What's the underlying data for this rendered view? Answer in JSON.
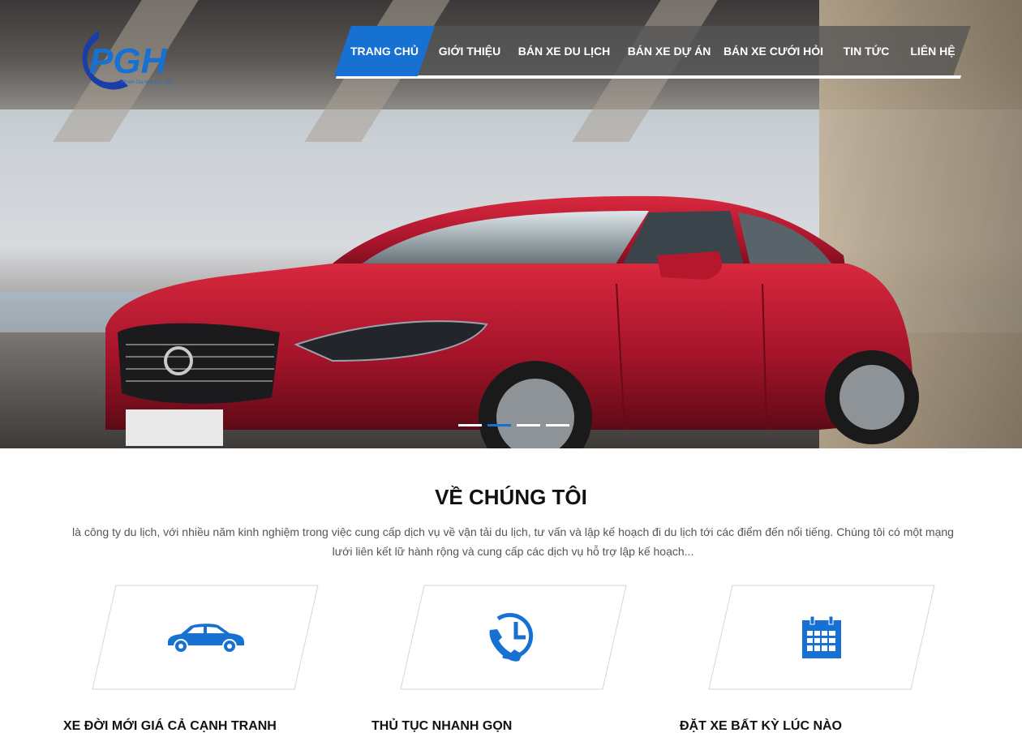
{
  "brand": {
    "logo_text": "PGH",
    "logo_subtext": "Pham Gia Huy Co., Ltd",
    "primary_color": "#1771d3",
    "dark_blue": "#1a3ea8"
  },
  "nav": {
    "items": [
      {
        "label": "TRANG CHỦ",
        "active": true
      },
      {
        "label": "GIỚI THIỆU"
      },
      {
        "label": "BÁN XE DU LỊCH"
      },
      {
        "label": "BÁN XE DỰ ÁN"
      },
      {
        "label": "BÁN XE CƯỚI HỎI"
      },
      {
        "label": "TIN TỨC"
      },
      {
        "label": "LIÊN HỆ"
      }
    ]
  },
  "slider": {
    "image": "red-sedan-car-photo",
    "slides": 4,
    "active_slide": 2
  },
  "about": {
    "title": "VỀ CHÚNG TÔI",
    "text": "là công ty du lịch, với nhiều năm kinh nghiệm trong việc cung cấp dịch vụ về vận tải du lịch, tư vấn và lập kế hoạch đi du lịch tới các điểm đến nổi tiếng. Chúng tôi có một mạng lưới liên kết lữ hành rộng và cung cấp các dịch vụ hỗ trợ lập kế hoạch..."
  },
  "features": [
    {
      "icon": "car-icon",
      "title": "XE ĐỜI MỚI GIÁ CẢ CẠNH TRANH"
    },
    {
      "icon": "phone-clock-icon",
      "title": "THỦ TỤC NHANH GỌN"
    },
    {
      "icon": "calendar-icon",
      "title": "ĐẶT XE BẤT KỲ LÚC NÀO"
    }
  ]
}
